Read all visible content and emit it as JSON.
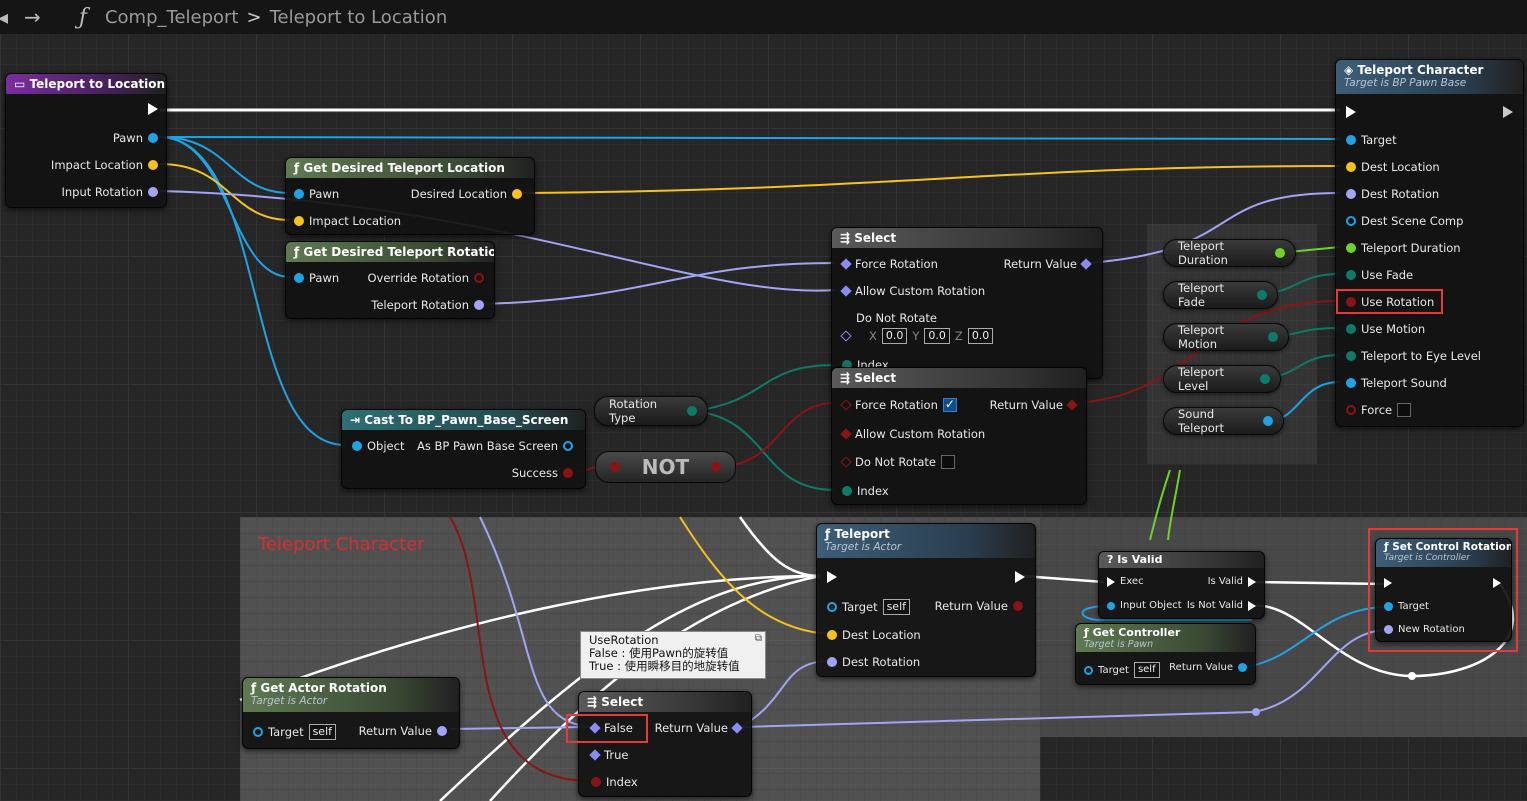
{
  "breadcrumb": {
    "function_icon": "ƒ",
    "back": "›",
    "forward": "→",
    "blueprint": "Comp_Teleport",
    "separator": ">",
    "graph": "Teleport to Location"
  },
  "comment": {
    "title": "Teleport Character"
  },
  "colors": {
    "exec": "#ffffff",
    "object": "#1ea3e6",
    "vector": "#f5c21e",
    "rotator": "#a0a5f5",
    "boolean": "#8a1414",
    "byte": "#0d7a6a",
    "float": "#6fd12a",
    "wildcard": "#8a8cf5",
    "highlight": "#e53a3a"
  },
  "nodes": {
    "teleport_to_location": {
      "title": "Teleport to Location",
      "pins": {
        "pawn": "Pawn",
        "impact": "Impact Location",
        "input_rotation": "Input Rotation"
      }
    },
    "get_desired_location": {
      "title": "Get Desired Teleport Location",
      "pins": {
        "pawn": "Pawn",
        "impact": "Impact Location",
        "desired": "Desired Location"
      }
    },
    "get_desired_rotation": {
      "title": "Get Desired Teleport Rotation",
      "pins": {
        "pawn": "Pawn",
        "override": "Override Rotation",
        "teleport_rotation": "Teleport Rotation"
      }
    },
    "select1": {
      "title": "Select",
      "pins": {
        "force": "Force Rotation",
        "allow": "Allow Custom Rotation",
        "do_not": "Do Not Rotate",
        "x_label": "X",
        "x": "0.0",
        "y_label": "Y",
        "y": "0.0",
        "z_label": "Z",
        "z": "0.0",
        "index": "Index",
        "return": "Return Value"
      }
    },
    "select2": {
      "title": "Select",
      "pins": {
        "force": "Force Rotation",
        "allow": "Allow Custom Rotation",
        "do_not": "Do Not Rotate",
        "index": "Index",
        "return": "Return Value"
      }
    },
    "cast": {
      "title": "Cast To BP_Pawn_Base_Screen",
      "pins": {
        "object": "Object",
        "as": "As BP Pawn Base Screen",
        "success": "Success"
      }
    },
    "rotation_type": {
      "label": "Rotation Type"
    },
    "not": {
      "label": "NOT"
    },
    "vars": [
      "Teleport Duration",
      "Teleport Fade",
      "Teleport Motion",
      "Teleport Level",
      "Sound Teleport"
    ],
    "teleport_character": {
      "title": "Teleport Character",
      "subtitle": "Target is BP Pawn Base",
      "pins": [
        "Target",
        "Dest Location",
        "Dest Rotation",
        "Dest Scene Comp",
        "Teleport Duration",
        "Use Fade",
        "Use Rotation",
        "Use Motion",
        "Teleport to Eye Level",
        "Teleport Sound",
        "Force"
      ]
    },
    "teleport": {
      "title": "Teleport",
      "subtitle": "Target is Actor",
      "pins": {
        "target": "Target",
        "self": "self",
        "return": "Return Value",
        "dest_loc": "Dest Location",
        "dest_rot": "Dest Rotation"
      }
    },
    "is_valid": {
      "title": "Is Valid",
      "pins": {
        "exec": "Exec",
        "input": "Input Object",
        "is_valid": "Is Valid",
        "is_not_valid": "Is Not Valid"
      }
    },
    "get_controller": {
      "title": "Get Controller",
      "subtitle": "Target is Pawn",
      "pins": {
        "target": "Target",
        "self": "self",
        "return": "Return Value"
      }
    },
    "set_control_rotation": {
      "title": "Set Control Rotation",
      "subtitle": "Target is Controller",
      "pins": {
        "target": "Target",
        "new_rotation": "New Rotation"
      }
    },
    "get_actor_rotation": {
      "title": "Get Actor Rotation",
      "subtitle": "Target is Actor",
      "pins": {
        "target": "Target",
        "self": "self",
        "return": "Return Value"
      }
    },
    "select3": {
      "title": "Select",
      "pins": {
        "false": "False",
        "true": "True",
        "index": "Index",
        "return": "Return Value"
      }
    }
  },
  "tooltip": {
    "line1": "UseRotation",
    "line2": "False : 使用Pawn的旋转值",
    "line3": "True : 使用瞬移目的地旋转值",
    "close": "⧉"
  }
}
